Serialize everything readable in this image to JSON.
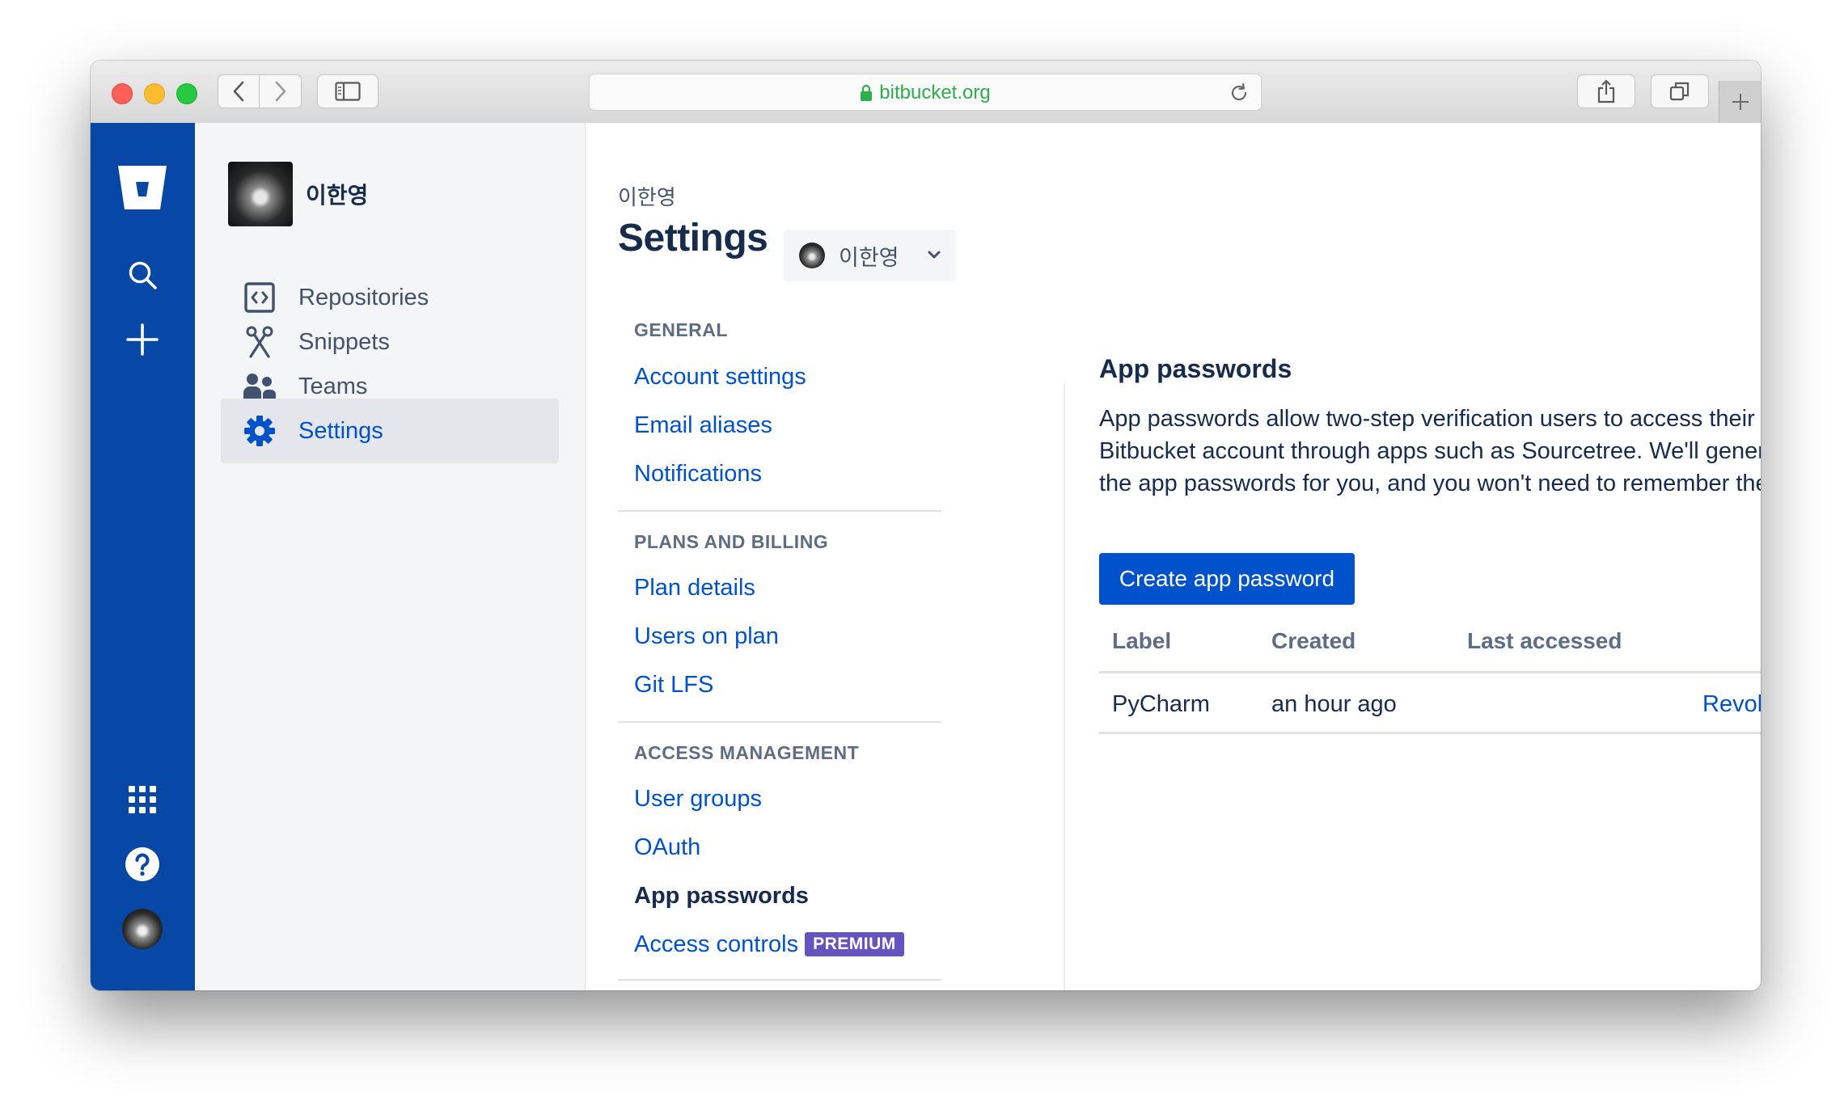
{
  "browser": {
    "url": "bitbucket.org",
    "lock_color": "#2cae4b"
  },
  "global_nav": {
    "background": "#0747a6",
    "icons": [
      "bitbucket-logo",
      "search-icon",
      "plus-icon",
      "app-switcher-icon",
      "help-icon",
      "avatar"
    ]
  },
  "sidebar": {
    "profile_name": "이한영",
    "items": [
      {
        "label": "Repositories",
        "icon": "repositories-icon"
      },
      {
        "label": "Snippets",
        "icon": "scissors-icon"
      },
      {
        "label": "Teams",
        "icon": "people-icon"
      },
      {
        "label": "Settings",
        "icon": "gear-icon",
        "active": true
      }
    ]
  },
  "main": {
    "breadcrumb": "이한영",
    "title": "Settings",
    "account_switcher": "이한영"
  },
  "settings_nav": {
    "sections": [
      {
        "heading": "GENERAL",
        "links": [
          "Account settings",
          "Email aliases",
          "Notifications"
        ]
      },
      {
        "heading": "PLANS AND BILLING",
        "links": [
          "Plan details",
          "Users on plan",
          "Git LFS"
        ]
      },
      {
        "heading": "ACCESS MANAGEMENT",
        "links": [
          "User groups",
          "OAuth",
          "App passwords",
          "Access controls"
        ]
      }
    ],
    "current": "App passwords",
    "premium_badge": "PREMIUM"
  },
  "content": {
    "heading": "App passwords",
    "description": "App passwords allow two-step verification users to access their Bitbucket account through apps such as Sourcetree. We'll generate the app passwords for you, and you won't need to remember them.",
    "create_button": "Create app password",
    "table": {
      "columns": [
        "Label",
        "Created",
        "Last accessed"
      ],
      "rows": [
        {
          "label": "PyCharm",
          "created": "an hour ago",
          "last_accessed": "",
          "action": "Revoke"
        }
      ]
    }
  },
  "colors": {
    "link": "#0052cc",
    "primary_button": "#0052cc",
    "premium_badge": "#6554c0",
    "text": "#172b4d"
  }
}
